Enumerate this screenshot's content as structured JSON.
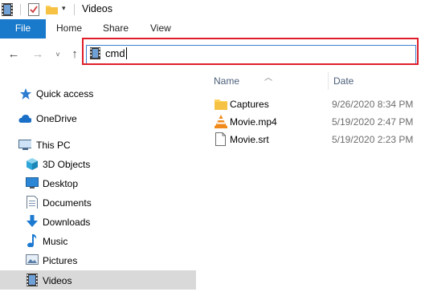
{
  "window": {
    "title": "Videos"
  },
  "ribbon": {
    "tabs": [
      "File",
      "Home",
      "Share",
      "View"
    ]
  },
  "address_bar": {
    "value": "cmd"
  },
  "nav_pane": {
    "quick_access": "Quick access",
    "onedrive": "OneDrive",
    "this_pc": "This PC",
    "items": [
      "3D Objects",
      "Desktop",
      "Documents",
      "Downloads",
      "Music",
      "Pictures",
      "Videos"
    ],
    "selected": "Videos"
  },
  "file_list": {
    "columns": {
      "name": "Name",
      "date": "Date"
    },
    "rows": [
      {
        "name": "Captures",
        "date": "9/26/2020 8:34 PM",
        "icon": "folder-icon"
      },
      {
        "name": "Movie.mp4",
        "date": "5/19/2020 2:47 PM",
        "icon": "vlc-icon"
      },
      {
        "name": "Movie.srt",
        "date": "5/19/2020 2:23 PM",
        "icon": "text-file-icon"
      }
    ]
  },
  "colors": {
    "accent": "#1979ca",
    "highlight_box": "#e01e2a",
    "selected_bg": "#d9d9d9",
    "column_header": "#4c607a"
  }
}
